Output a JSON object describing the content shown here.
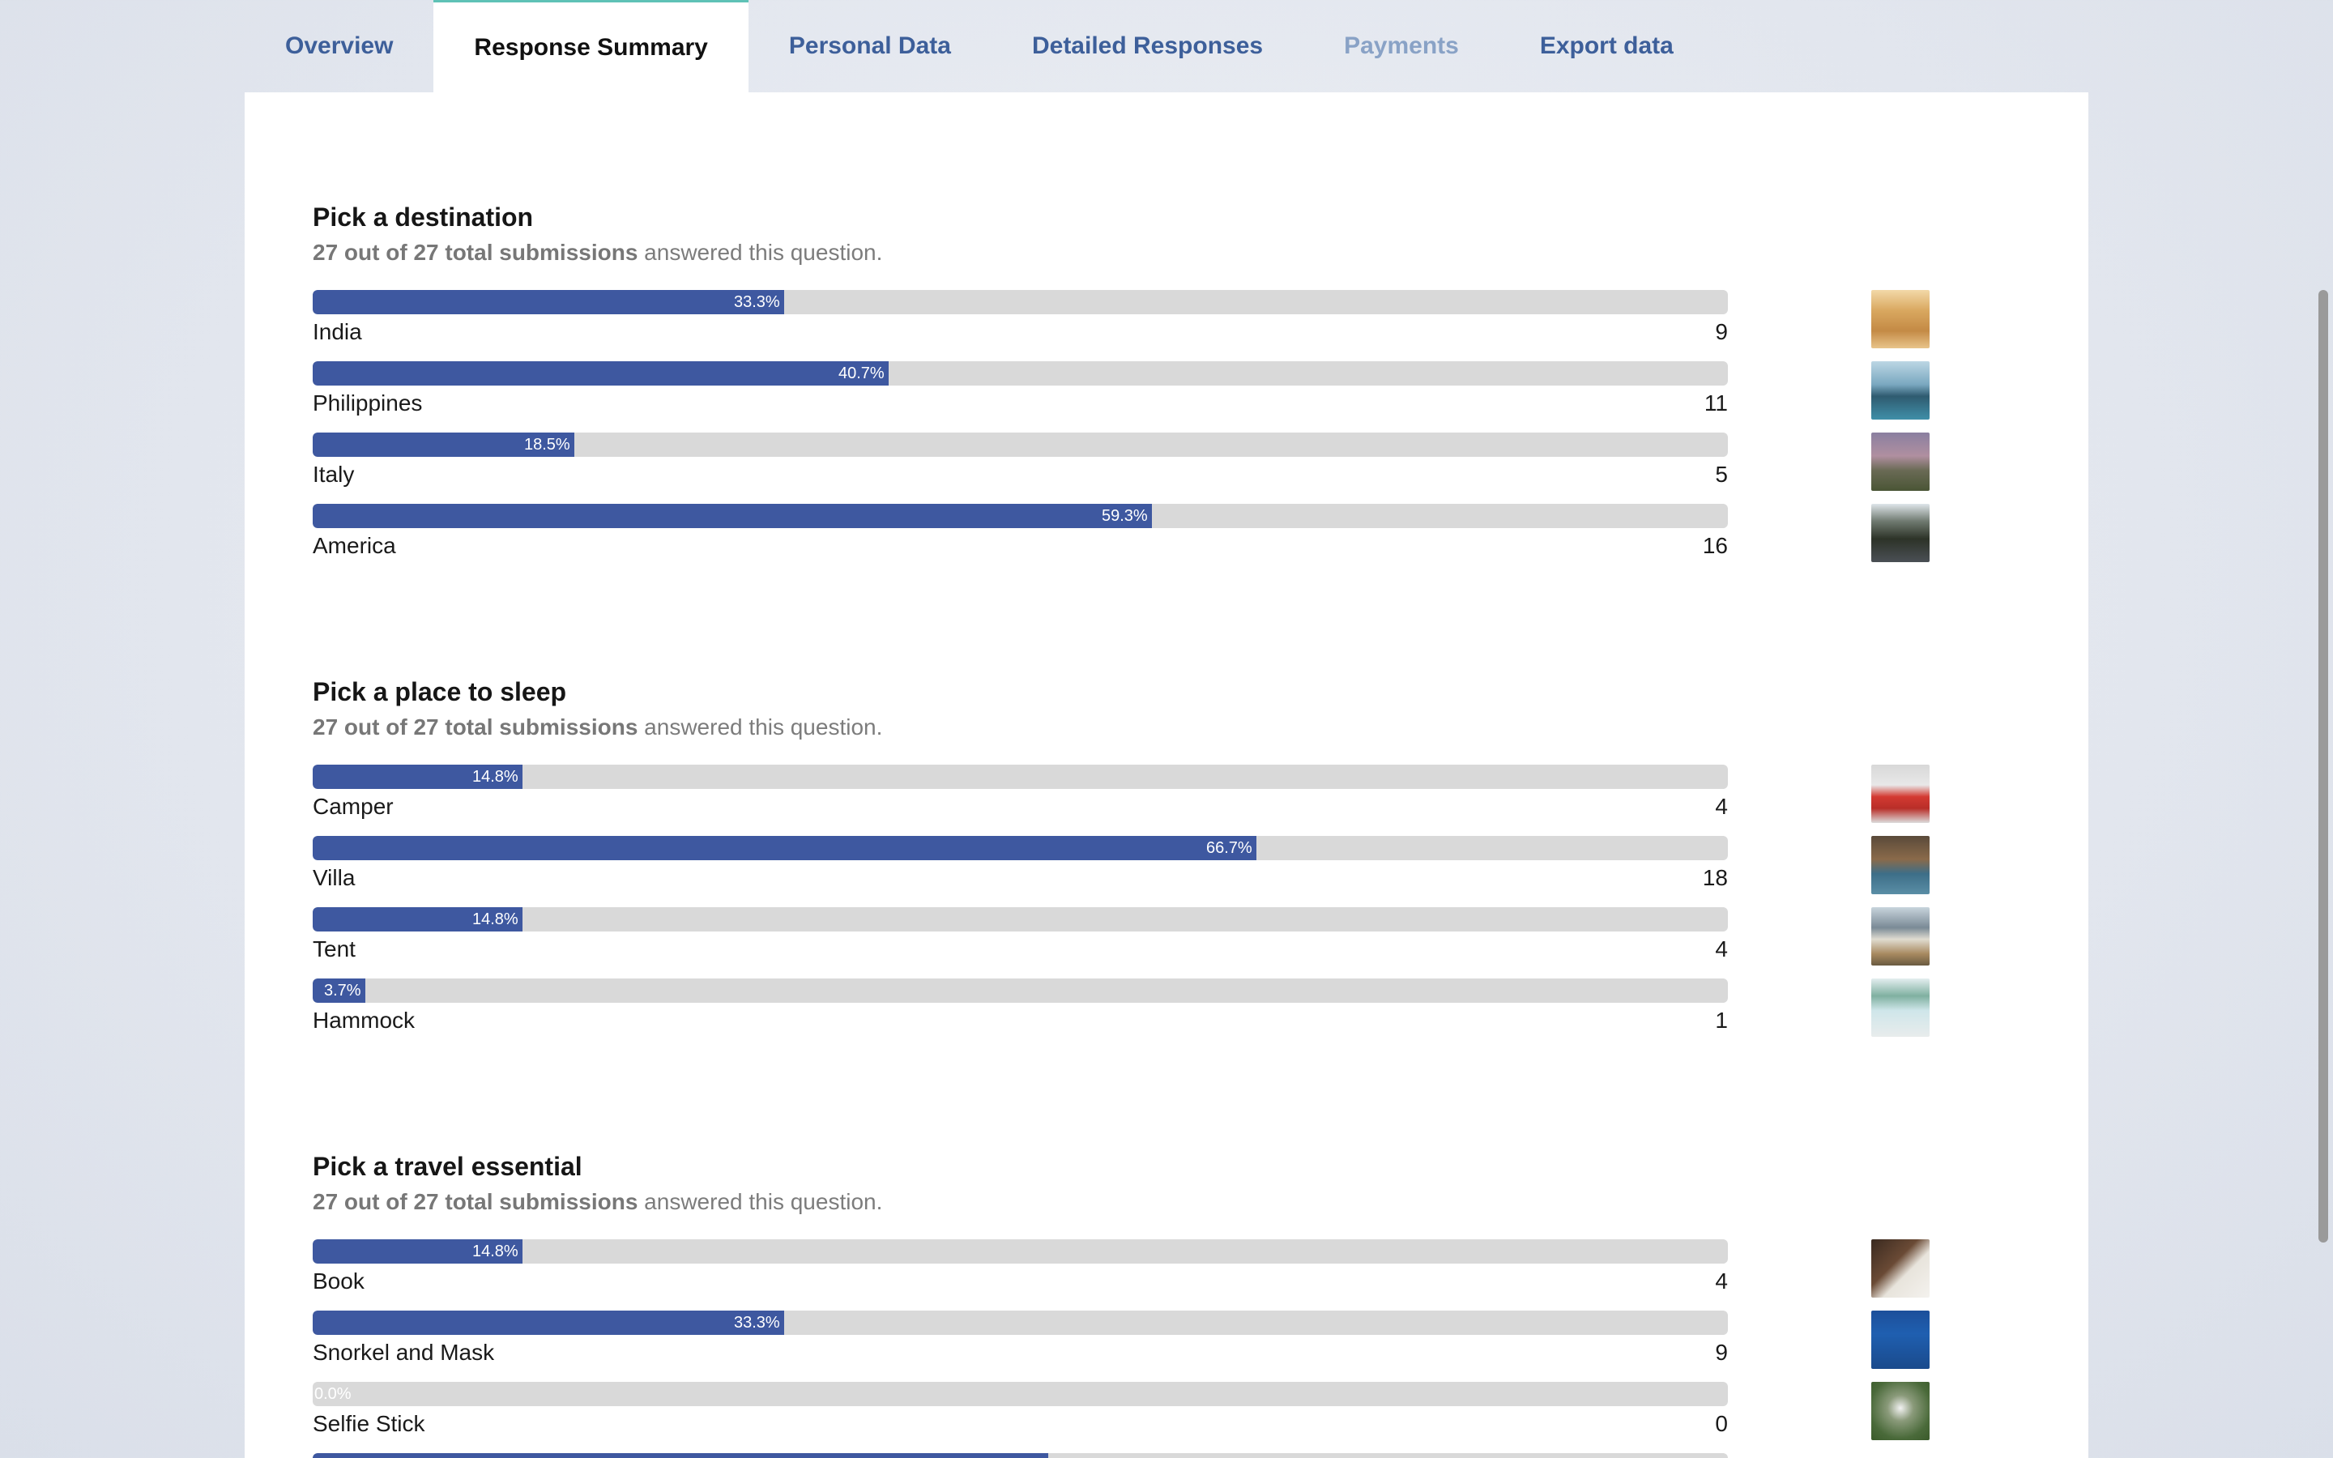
{
  "tabs": [
    {
      "label": "Overview"
    },
    {
      "label": "Response Summary"
    },
    {
      "label": "Personal Data"
    },
    {
      "label": "Detailed Responses"
    },
    {
      "label": "Payments"
    },
    {
      "label": "Export data"
    }
  ],
  "questions": [
    {
      "title": "Pick a destination",
      "summary_bold": "27 out of 27 total submissions",
      "summary_rest": " answered this question.",
      "answers": [
        {
          "label": "India",
          "pct": "33.3%",
          "fraction": 0.333,
          "count": "9",
          "thumb": "palace-photo"
        },
        {
          "label": "Philippines",
          "pct": "40.7%",
          "fraction": 0.407,
          "count": "11",
          "thumb": "island-rock-photo"
        },
        {
          "label": "Italy",
          "pct": "18.5%",
          "fraction": 0.185,
          "count": "5",
          "thumb": "hillside-dusk-photo"
        },
        {
          "label": "America",
          "pct": "59.3%",
          "fraction": 0.593,
          "count": "16",
          "thumb": "forest-road-photo"
        }
      ]
    },
    {
      "title": "Pick a place to sleep",
      "summary_bold": "27 out of 27 total submissions",
      "summary_rest": " answered this question.",
      "answers": [
        {
          "label": "Camper",
          "pct": "14.8%",
          "fraction": 0.148,
          "count": "4",
          "thumb": "red-van-photo"
        },
        {
          "label": "Villa",
          "pct": "66.7%",
          "fraction": 0.667,
          "count": "18",
          "thumb": "villa-pool-photo"
        },
        {
          "label": "Tent",
          "pct": "14.8%",
          "fraction": 0.148,
          "count": "4",
          "thumb": "tent-mountain-photo"
        },
        {
          "label": "Hammock",
          "pct": "3.7%",
          "fraction": 0.037,
          "count": "1",
          "thumb": "beach-hammock-photo"
        }
      ]
    },
    {
      "title": "Pick a travel essential",
      "summary_bold": "27 out of 27 total submissions",
      "summary_rest": " answered this question.",
      "answers": [
        {
          "label": "Book",
          "pct": "14.8%",
          "fraction": 0.148,
          "count": "4",
          "thumb": "book-reading-photo"
        },
        {
          "label": "Snorkel and Mask",
          "pct": "33.3%",
          "fraction": 0.333,
          "count": "9",
          "thumb": "diver-underwater-photo"
        },
        {
          "label": "Selfie Stick",
          "pct": "0.0%",
          "fraction": 0.0,
          "count": "0",
          "thumb": "selfie-stick-photo"
        },
        {
          "label": "",
          "pct": "",
          "fraction": 0.52,
          "count": "",
          "thumb": ""
        }
      ]
    }
  ],
  "colors": {
    "bar_fill": "#3e58a0",
    "bar_track": "#d9d9d9",
    "tab_link": "#3d5f9a",
    "tab_disabled": "#89a2c6",
    "active_tab_accent": "#5fc2b6"
  }
}
